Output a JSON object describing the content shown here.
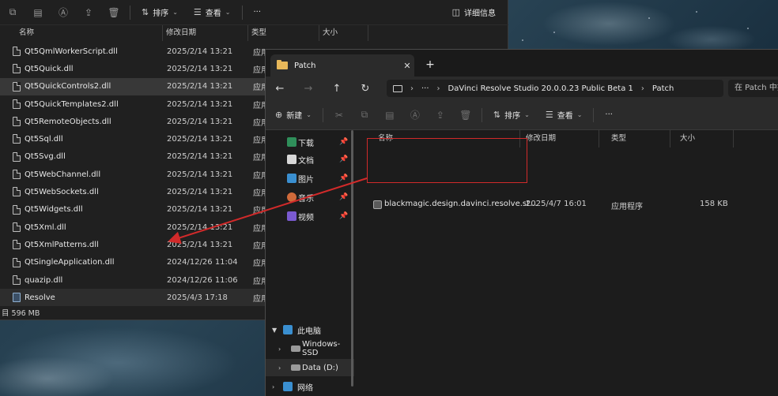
{
  "win1": {
    "toolbar": {
      "sort_label": "排序",
      "view_label": "查看",
      "more_label": "···",
      "details_label": "详细信息"
    },
    "columns": [
      "名称",
      "修改日期",
      "类型",
      "大小"
    ],
    "rows": [
      {
        "name": "Qt5QmlWorkerScript.dll",
        "date": "2025/2/14 13:21",
        "type": "应用"
      },
      {
        "name": "Qt5Quick.dll",
        "date": "2025/2/14 13:21",
        "type": "应用"
      },
      {
        "name": "Qt5QuickControls2.dll",
        "date": "2025/2/14 13:21",
        "type": "应用"
      },
      {
        "name": "Qt5QuickTemplates2.dll",
        "date": "2025/2/14 13:21",
        "type": "应用"
      },
      {
        "name": "Qt5RemoteObjects.dll",
        "date": "2025/2/14 13:21",
        "type": "应用"
      },
      {
        "name": "Qt5Sql.dll",
        "date": "2025/2/14 13:21",
        "type": "应用"
      },
      {
        "name": "Qt5Svg.dll",
        "date": "2025/2/14 13:21",
        "type": "应用"
      },
      {
        "name": "Qt5WebChannel.dll",
        "date": "2025/2/14 13:21",
        "type": "应用"
      },
      {
        "name": "Qt5WebSockets.dll",
        "date": "2025/2/14 13:21",
        "type": "应用"
      },
      {
        "name": "Qt5Widgets.dll",
        "date": "2025/2/14 13:21",
        "type": "应用"
      },
      {
        "name": "Qt5Xml.dll",
        "date": "2025/2/14 13:21",
        "type": "应用"
      },
      {
        "name": "Qt5XmlPatterns.dll",
        "date": "2025/2/14 13:21",
        "type": "应用"
      },
      {
        "name": "QtSingleApplication.dll",
        "date": "2024/12/26 11:04",
        "type": "应用"
      },
      {
        "name": "quazip.dll",
        "date": "2024/12/26 11:06",
        "type": "应用"
      },
      {
        "name": "Resolve",
        "date": "2025/4/3 17:18",
        "type": "应用"
      }
    ],
    "status": "目 596 MB"
  },
  "win2": {
    "tab_title": "Patch",
    "new_tab": "+",
    "tab_close": "✕",
    "breadcrumb": [
      "···",
      "DaVinci Resolve Studio 20.0.0.23 Public Beta 1",
      "Patch"
    ],
    "search_placeholder": "在 Patch 中搜索",
    "cmd": {
      "new_label": "新建",
      "sort_label": "排序",
      "view_label": "查看",
      "more_label": "···"
    },
    "sidebar": [
      {
        "label": "下载",
        "pinned": true
      },
      {
        "label": "文档",
        "pinned": true
      },
      {
        "label": "图片",
        "pinned": true
      },
      {
        "label": "音乐",
        "pinned": true
      },
      {
        "label": "视频",
        "pinned": true
      },
      {
        "label": "此电脑"
      },
      {
        "label": "Windows-SSD"
      },
      {
        "label": "Data (D:)"
      },
      {
        "label": "网络"
      }
    ],
    "columns": [
      "名称",
      "修改日期",
      "类型",
      "大小"
    ],
    "file": {
      "name": "blackmagic.design.davinci.resolve.st...",
      "date": "2025/4/7 16:01",
      "type": "应用程序",
      "size": "158 KB"
    }
  },
  "colors": {
    "highlight": "#d12a2a",
    "folder": "#e8b85a"
  }
}
